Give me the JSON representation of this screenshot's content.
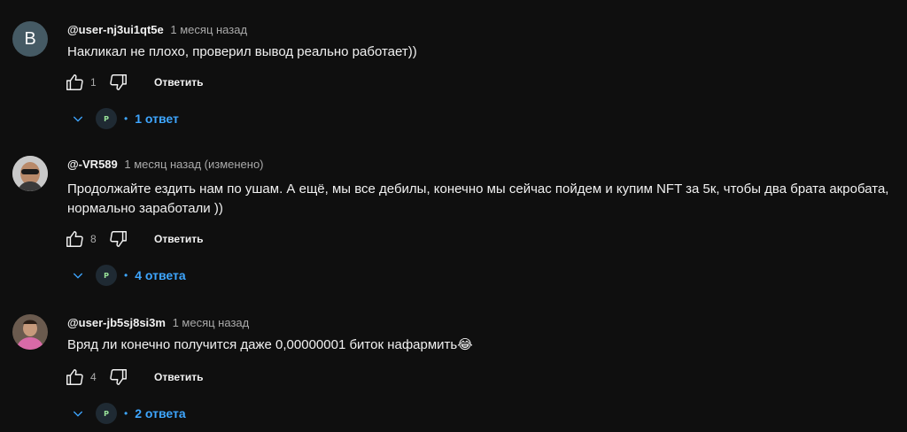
{
  "comments": [
    {
      "avatar_letter": "B",
      "author": "@user-nj3ui1qt5e",
      "time": "1 месяц назад",
      "text": "Накликал не плохо, проверил вывод реально работает))",
      "likes": "1",
      "reply_label": "Ответить",
      "replies": "1 ответ"
    },
    {
      "author": "@-VR589",
      "time": "1 месяц назад (изменено)",
      "text": "Продолжайте ездить нам по ушам. А ещё, мы все дебилы, конечно мы сейчас пойдем и купим NFT за 5к, чтобы два брата акробата, нормально заработали ))",
      "likes": "8",
      "reply_label": "Ответить",
      "replies": "4 ответа"
    },
    {
      "author": "@user-jb5sj8si3m",
      "time": "1 месяц назад",
      "text": "Вряд ли конечно получится даже 0,00000001 биток нафармить😂",
      "likes": "4",
      "reply_label": "Ответить",
      "replies": "2 ответа"
    }
  ],
  "colors": {
    "background": "#0f0f0f",
    "link": "#3ea6ff",
    "secondary_text": "#aaaaaa"
  }
}
